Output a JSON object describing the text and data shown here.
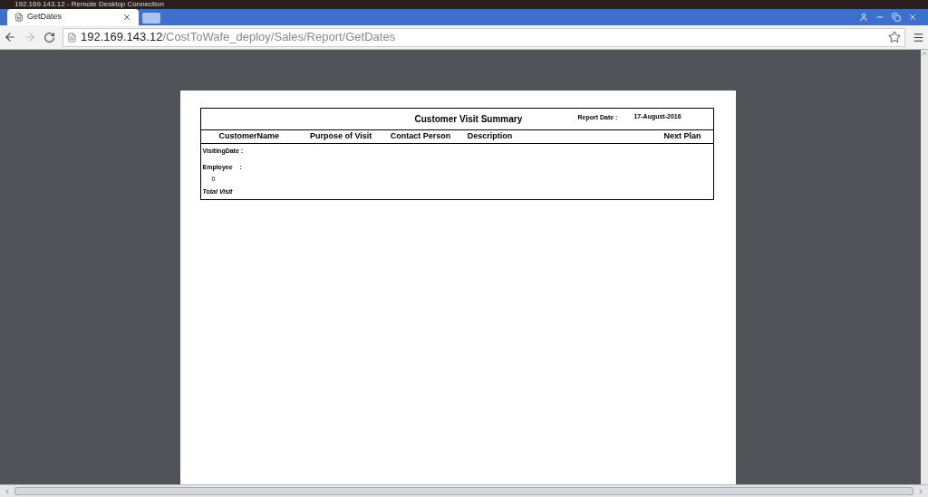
{
  "remote_title": "192.169.143.12 - Remote Desktop Connection",
  "tabs": [
    {
      "kind": "page",
      "label": "GetDates",
      "selected": true
    },
    {
      "kind": "new",
      "selected": false
    }
  ],
  "address": {
    "host": "192.169.143.12",
    "path": "/CostToWafe_deploy/Sales/Report/GetDates"
  },
  "report": {
    "title": "Customer Visit Summary",
    "date_label": "Report Date :",
    "date_value": "17-August-2016",
    "columns": [
      "CustomerName",
      "Purpose of Visit",
      "Contact Person",
      "Description",
      "Next Plan"
    ],
    "visiting_date_label": "VisitingDate :",
    "employee_label": "Employee",
    "employee_colon": ":",
    "employee_value": "0",
    "total_label": "Total Visit"
  }
}
